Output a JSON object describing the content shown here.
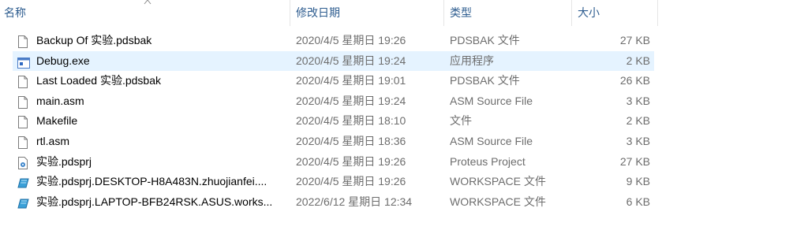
{
  "columns": {
    "name": "名称",
    "date": "修改日期",
    "type": "类型",
    "size": "大小"
  },
  "colors": {
    "header_text": "#2d5c8f",
    "selected_row": "#e5f3ff",
    "meta_text": "#6d6d6d"
  },
  "selected_index": 1,
  "files": [
    {
      "name": "Backup Of 实验.pdsbak",
      "date": "2020/4/5 星期日 19:26",
      "type": "PDSBAK 文件",
      "size": "27 KB",
      "icon": "document-icon"
    },
    {
      "name": "Debug.exe",
      "date": "2020/4/5 星期日 19:24",
      "type": "应用程序",
      "size": "2 KB",
      "icon": "application-icon"
    },
    {
      "name": "Last Loaded 实验.pdsbak",
      "date": "2020/4/5 星期日 19:01",
      "type": "PDSBAK 文件",
      "size": "26 KB",
      "icon": "document-icon"
    },
    {
      "name": "main.asm",
      "date": "2020/4/5 星期日 19:24",
      "type": "ASM Source File",
      "size": "3 KB",
      "icon": "document-icon"
    },
    {
      "name": "Makefile",
      "date": "2020/4/5 星期日 18:10",
      "type": "文件",
      "size": "2 KB",
      "icon": "document-icon"
    },
    {
      "name": "rtl.asm",
      "date": "2020/4/5 星期日 18:36",
      "type": "ASM Source File",
      "size": "3 KB",
      "icon": "document-icon"
    },
    {
      "name": "实验.pdsprj",
      "date": "2020/4/5 星期日 19:26",
      "type": "Proteus Project",
      "size": "27 KB",
      "icon": "proteus-project-icon"
    },
    {
      "name": "实验.pdsprj.DESKTOP-H8A483N.zhuojianfei....",
      "date": "2020/4/5 星期日 19:26",
      "type": "WORKSPACE 文件",
      "size": "9 KB",
      "icon": "workspace-icon"
    },
    {
      "name": "实验.pdsprj.LAPTOP-BFB24RSK.ASUS.works...",
      "date": "2022/6/12 星期日 12:34",
      "type": "WORKSPACE 文件",
      "size": "6 KB",
      "icon": "workspace-icon"
    }
  ]
}
